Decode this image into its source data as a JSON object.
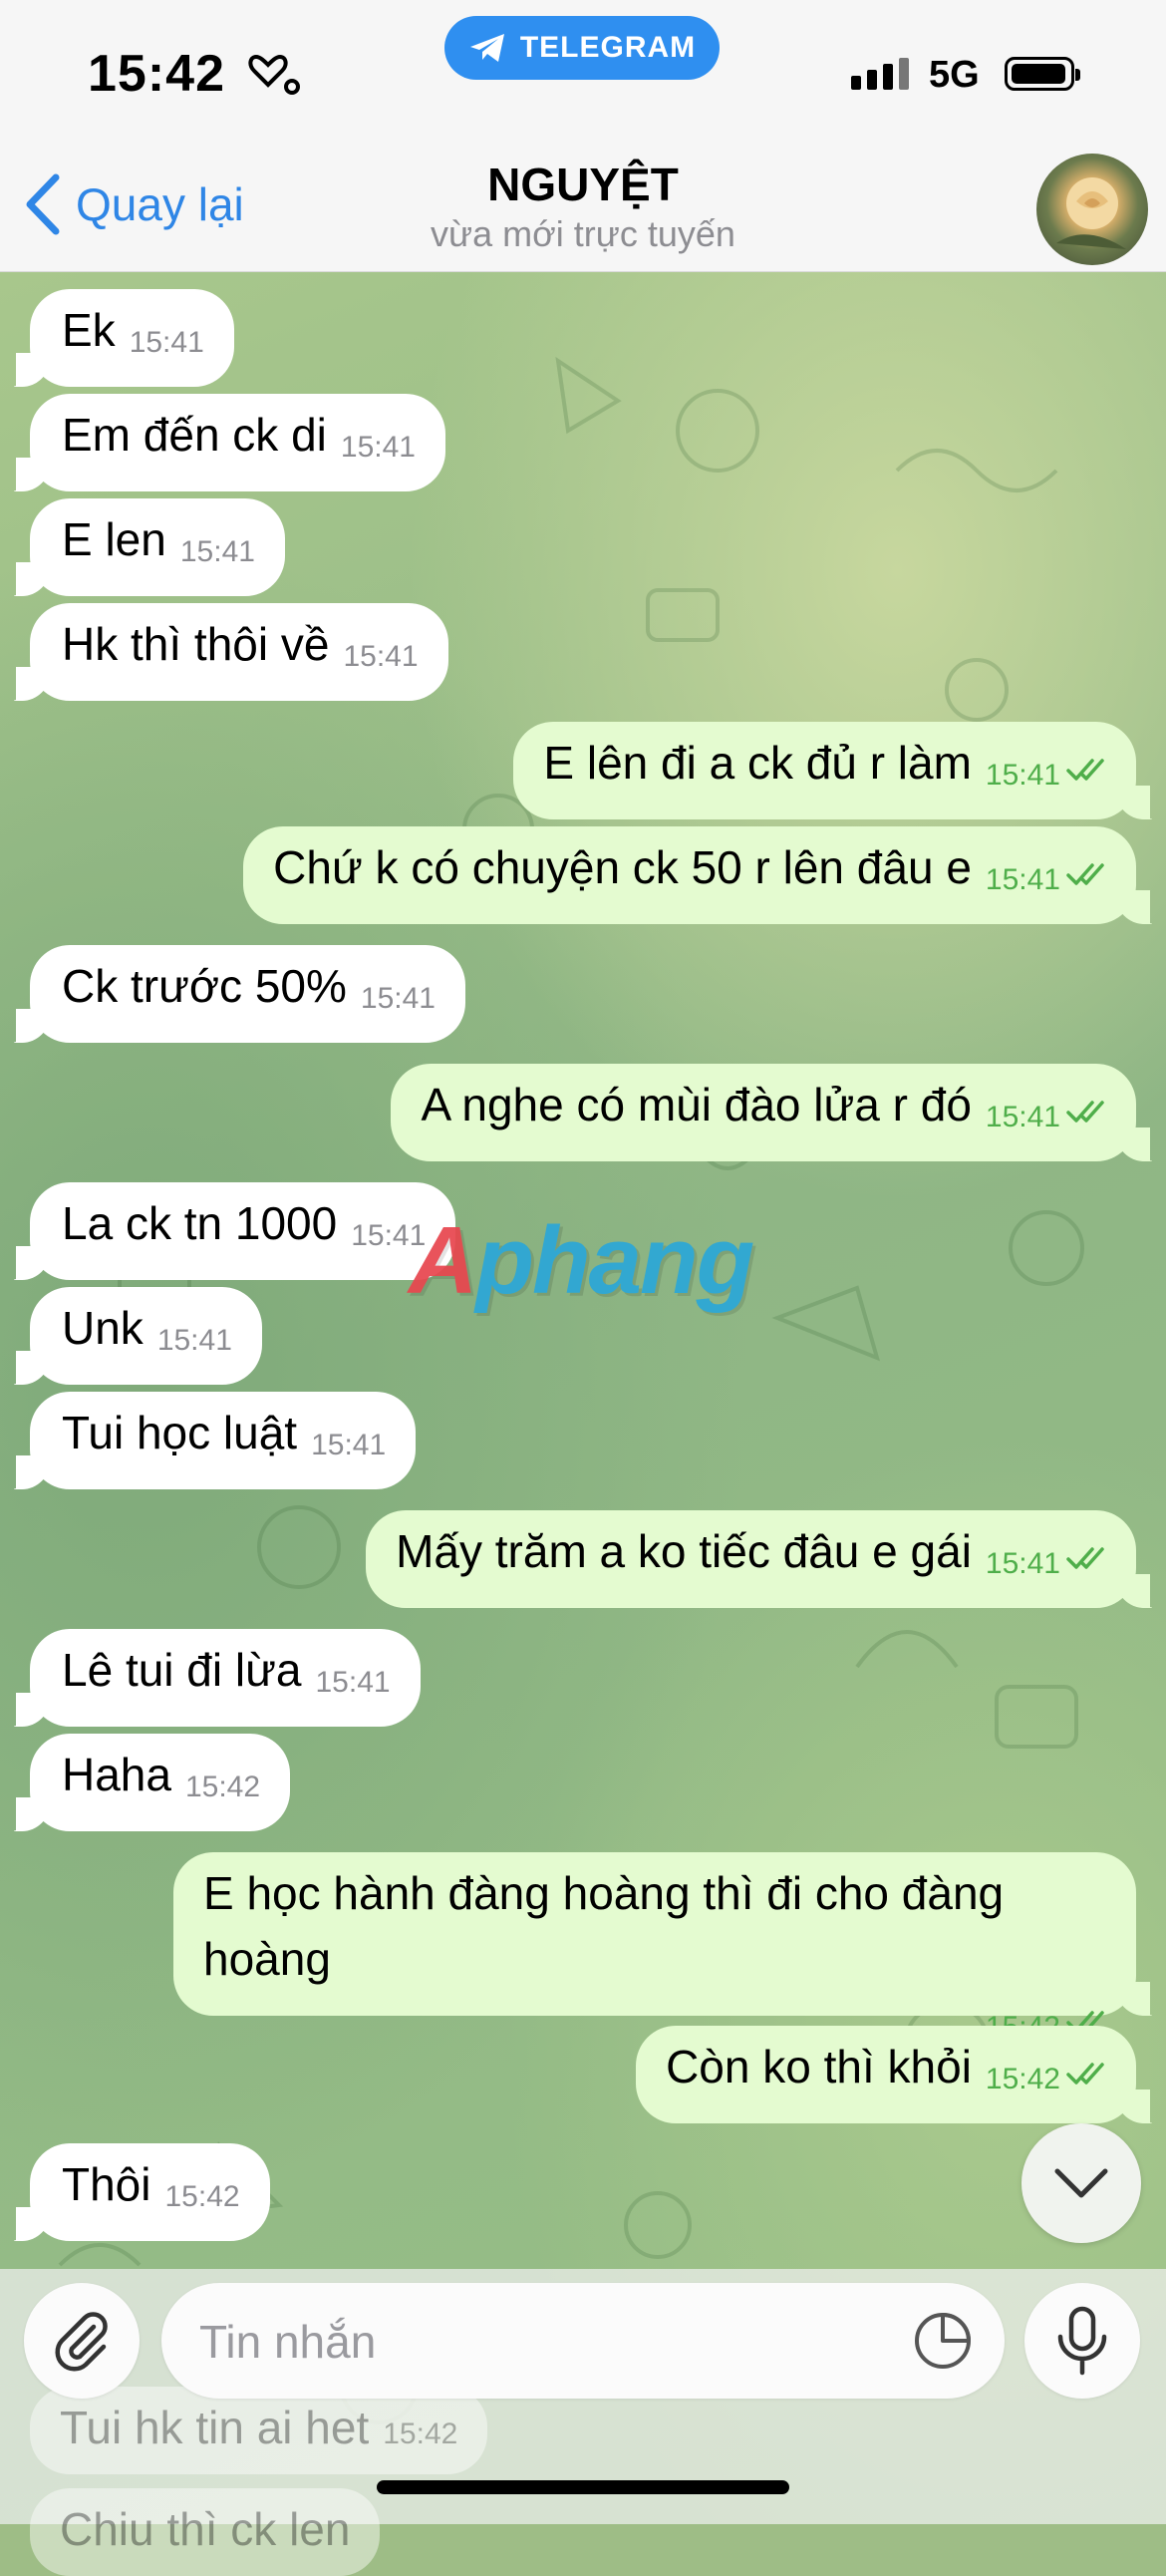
{
  "status_bar": {
    "time": "15:42",
    "telegram_label": "TELEGRAM",
    "network": "5G"
  },
  "header": {
    "back_label": "Quay lại",
    "title": "NGUYỆT",
    "subtitle": "vừa mới trực tuyến"
  },
  "messages": [
    {
      "dir": "in",
      "text": "Ek",
      "time": "15:41"
    },
    {
      "dir": "in",
      "text": "Em đến ck di",
      "time": "15:41"
    },
    {
      "dir": "in",
      "text": "E len",
      "time": "15:41"
    },
    {
      "dir": "in",
      "text": "Hk thì thôi về",
      "time": "15:41"
    },
    {
      "dir": "out",
      "text": "E lên đi a ck đủ r làm",
      "time": "15:41"
    },
    {
      "dir": "out",
      "text": "Chứ k có chuyện ck 50 r lên đâu e",
      "time": "15:41"
    },
    {
      "dir": "in",
      "text": "Ck trước 50%",
      "time": "15:41"
    },
    {
      "dir": "out",
      "text": "A nghe có mùi đào lửa r đó",
      "time": "15:41"
    },
    {
      "dir": "in",
      "text": "La ck tn 1000",
      "time": "15:41"
    },
    {
      "dir": "in",
      "text": "Unk",
      "time": "15:41"
    },
    {
      "dir": "in",
      "text": "Tui học luật",
      "time": "15:41"
    },
    {
      "dir": "out",
      "text": "Mấy trăm a ko tiếc đâu e gái",
      "time": "15:41"
    },
    {
      "dir": "in",
      "text": "Lê tui đi lừa",
      "time": "15:41"
    },
    {
      "dir": "in",
      "text": "Haha",
      "time": "15:42"
    },
    {
      "dir": "out",
      "text": "E học hành đàng hoàng thì đi cho đàng hoàng",
      "time": "15:42"
    },
    {
      "dir": "out",
      "text": "Còn ko thì khỏi",
      "time": "15:42"
    },
    {
      "dir": "in",
      "text": "Thôi",
      "time": "15:42"
    },
    {
      "dir": "in",
      "text": "Tui hk tin ai het",
      "time": "15:42"
    },
    {
      "dir": "in",
      "text": "Chiu thì ck len",
      "time": ""
    }
  ],
  "watermark": {
    "first": "A",
    "rest": "phang"
  },
  "composer": {
    "placeholder": "Tin nhắn"
  },
  "icons": [
    "telegram-icon",
    "heart-stethoscope-icon",
    "signal-icon",
    "battery-icon",
    "back-chevron-icon",
    "paperclip-icon",
    "sticker-icon",
    "microphone-icon",
    "chevron-down-icon",
    "double-check-icon"
  ],
  "colors": {
    "accent": "#2f86e6",
    "outgoing_bubble": "#e4fbd0",
    "incoming_bubble": "#ffffff",
    "read_check": "#4fae4a"
  }
}
